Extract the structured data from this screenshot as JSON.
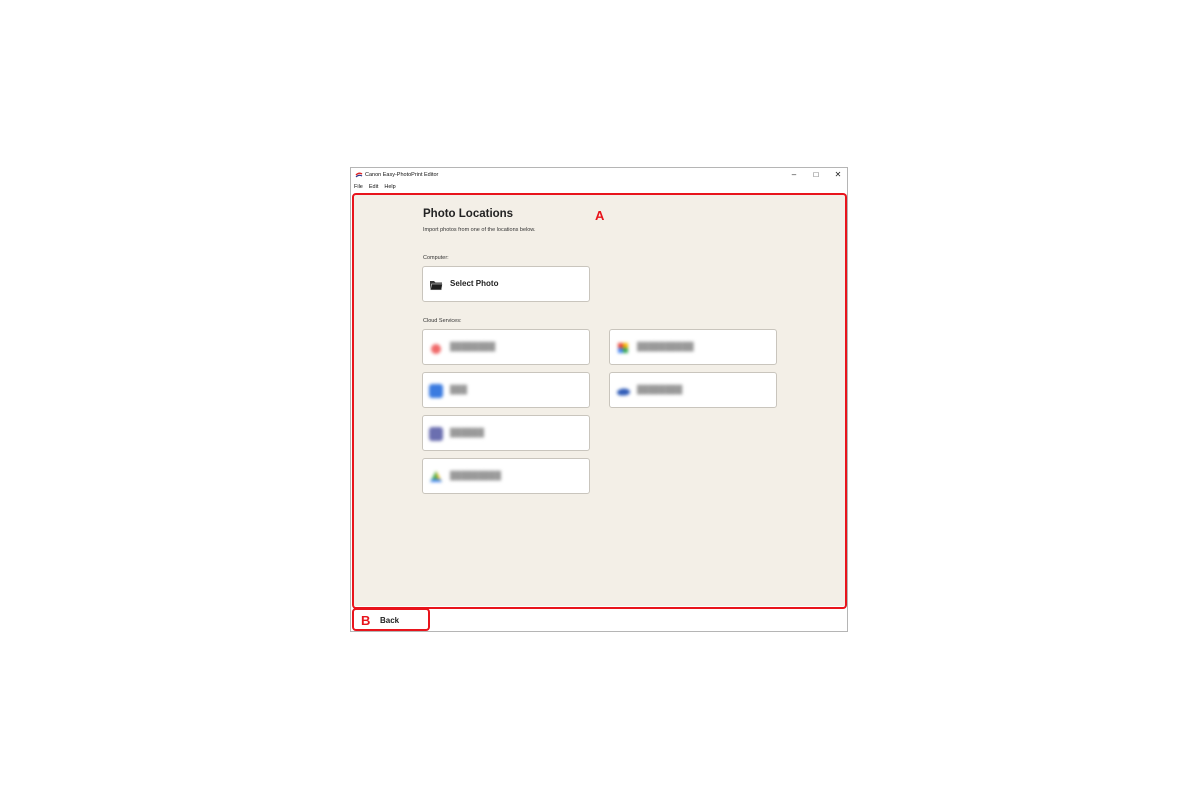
{
  "window": {
    "title": "Canon Easy-PhotoPrint Editor",
    "controls": {
      "minimize": "–",
      "maximize": "□",
      "close": "✕"
    }
  },
  "menu": [
    {
      "label": "File"
    },
    {
      "label": "Edit"
    },
    {
      "label": "Help"
    }
  ],
  "main": {
    "title": "Photo Locations",
    "subtitle": "Import photos from one of the locations below.",
    "computer_label": "Computer:",
    "select_photo": {
      "label": "Select Photo",
      "icon": "folder-icon"
    },
    "cloud_label": "Cloud Services:",
    "cloud_services": [
      {
        "icon": "red-service-icon",
        "color": "#f06a6a"
      },
      {
        "icon": "blue-square-icon",
        "color": "#3b7be0"
      },
      {
        "icon": "purple-square-icon",
        "color": "#6b6fb0"
      },
      {
        "icon": "multicolor-drive-icon",
        "color": "#4caf50"
      },
      {
        "icon": "pinwheel-icon",
        "color": "#f4b400"
      },
      {
        "icon": "cloud-icon",
        "color": "#2f5bb7"
      }
    ]
  },
  "footer": {
    "back_label": "Back"
  },
  "annotations": {
    "a": "A",
    "b": "B"
  },
  "colors": {
    "annotation": "#e8141c",
    "content_bg": "#f3efe7"
  }
}
